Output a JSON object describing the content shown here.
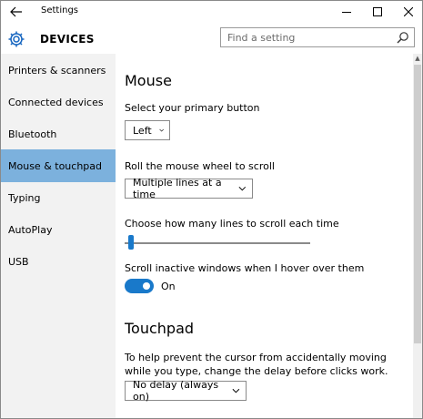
{
  "window": {
    "title": "Settings",
    "back_icon": "back-arrow-icon",
    "controls": [
      "minimize-icon",
      "maximize-icon",
      "close-icon"
    ]
  },
  "header": {
    "icon": "gear-icon",
    "title": "DEVICES",
    "accent_color": "#1565c0"
  },
  "search": {
    "placeholder": "Find a setting",
    "value": "",
    "icon": "search-icon"
  },
  "sidebar": {
    "active_color": "#7cb1dd",
    "items": [
      {
        "label": "Printers & scanners",
        "active": false
      },
      {
        "label": "Connected devices",
        "active": false
      },
      {
        "label": "Bluetooth",
        "active": false
      },
      {
        "label": "Mouse & touchpad",
        "active": true
      },
      {
        "label": "Typing",
        "active": false
      },
      {
        "label": "AutoPlay",
        "active": false
      },
      {
        "label": "USB",
        "active": false
      }
    ]
  },
  "mouse": {
    "heading": "Mouse",
    "primary_button_label": "Select your primary button",
    "primary_button_value": "Left",
    "wheel_label": "Roll the mouse wheel to scroll",
    "wheel_value": "Multiple lines at a time",
    "lines_label": "Choose how many lines to scroll each time",
    "lines_slider_fraction": 0.02,
    "inactive_label": "Scroll inactive windows when I hover over them",
    "inactive_toggle_state": "On",
    "toggle_color": "#1979ca"
  },
  "touchpad": {
    "heading": "Touchpad",
    "delay_description": "To help prevent the cursor from accidentally moving while you type, change the delay before clicks work.",
    "delay_value": "No delay (always on)"
  }
}
